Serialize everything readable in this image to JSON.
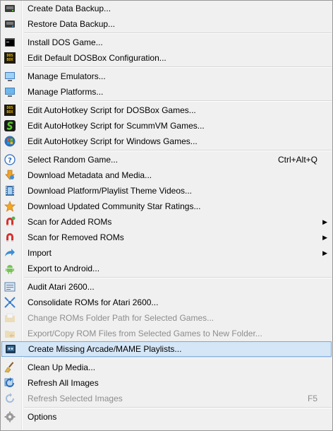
{
  "menu": {
    "items": [
      {
        "label": "Create Data Backup...",
        "icon": "backup-drive-icon"
      },
      {
        "label": "Restore Data Backup...",
        "icon": "restore-drive-icon"
      },
      {
        "label": "Install DOS Game...",
        "icon": "dos-prompt-icon"
      },
      {
        "label": "Edit Default DOSBox Configuration...",
        "icon": "dosbox-icon"
      },
      {
        "label": "Manage Emulators...",
        "icon": "emulator-monitor-icon"
      },
      {
        "label": "Manage Platforms...",
        "icon": "platform-monitor-icon"
      },
      {
        "label": "Edit AutoHotkey Script for DOSBox Games...",
        "icon": "dosbox-icon"
      },
      {
        "label": "Edit AutoHotkey Script for ScummVM Games...",
        "icon": "scummvm-icon"
      },
      {
        "label": "Edit AutoHotkey Script for Windows Games...",
        "icon": "windows-icon"
      },
      {
        "label": "Select Random Game...",
        "shortcut": "Ctrl+Alt+Q",
        "icon": "question-icon"
      },
      {
        "label": "Download Metadata and Media...",
        "icon": "download-icon"
      },
      {
        "label": "Download Platform/Playlist Theme Videos...",
        "icon": "film-icon"
      },
      {
        "label": "Download Updated Community Star Ratings...",
        "icon": "star-icon"
      },
      {
        "label": "Scan for Added ROMs",
        "icon": "magnet-add-icon",
        "submenu": "▶"
      },
      {
        "label": "Scan for Removed ROMs",
        "icon": "magnet-remove-icon",
        "submenu": "▶"
      },
      {
        "label": "Import",
        "icon": "import-arrow-icon",
        "submenu": "▶"
      },
      {
        "label": "Export to Android...",
        "icon": "android-icon"
      },
      {
        "label": "Audit Atari 2600...",
        "icon": "audit-icon"
      },
      {
        "label": "Consolidate ROMs for Atari 2600...",
        "icon": "consolidate-icon"
      },
      {
        "label": "Change ROMs Folder Path for Selected Games...",
        "icon": "folder-icon"
      },
      {
        "label": "Export/Copy ROM Files from Selected Games to New Folder...",
        "icon": "folder-export-icon"
      },
      {
        "label": "Create Missing Arcade/MAME Playlists...",
        "icon": "arcade-icon"
      },
      {
        "label": "Clean Up Media...",
        "icon": "broom-icon"
      },
      {
        "label": "Refresh All Images",
        "icon": "refresh-icon"
      },
      {
        "label": "Refresh Selected Images",
        "shortcut": "F5",
        "icon": "refresh-icon"
      },
      {
        "label": "Options",
        "icon": "gear-icon"
      }
    ],
    "dosbox_icon_text": [
      "DOS",
      "BOX"
    ],
    "colors": {
      "highlight_bg": "#d5e6f7",
      "highlight_border": "#7aa9d9",
      "disabled_text": "#8d8d8d"
    }
  }
}
